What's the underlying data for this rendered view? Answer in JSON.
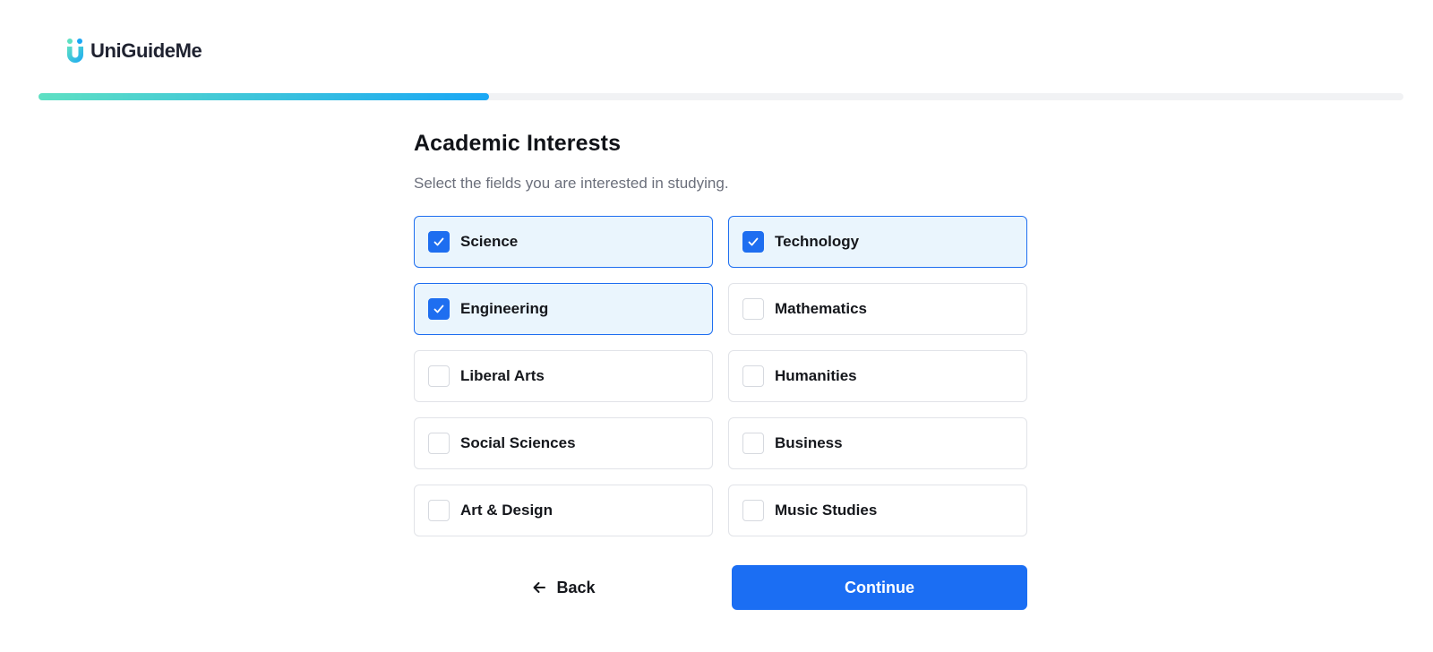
{
  "brand": {
    "name": "UniGuideMe",
    "colors": {
      "accent": "#1b6ef3",
      "teal": "#5ee0c3",
      "sky": "#1aa7f5"
    }
  },
  "progress": {
    "fraction": 0.33
  },
  "page": {
    "title": "Academic Interests",
    "subtitle": "Select the fields you are interested in studying."
  },
  "options": [
    {
      "label": "Science",
      "selected": true
    },
    {
      "label": "Technology",
      "selected": true
    },
    {
      "label": "Engineering",
      "selected": true
    },
    {
      "label": "Mathematics",
      "selected": false
    },
    {
      "label": "Liberal Arts",
      "selected": false
    },
    {
      "label": "Humanities",
      "selected": false
    },
    {
      "label": "Social Sciences",
      "selected": false
    },
    {
      "label": "Business",
      "selected": false
    },
    {
      "label": "Art & Design",
      "selected": false
    },
    {
      "label": "Music Studies",
      "selected": false
    }
  ],
  "actions": {
    "back_label": "Back",
    "back_icon": "arrow-left-icon",
    "continue_label": "Continue"
  }
}
